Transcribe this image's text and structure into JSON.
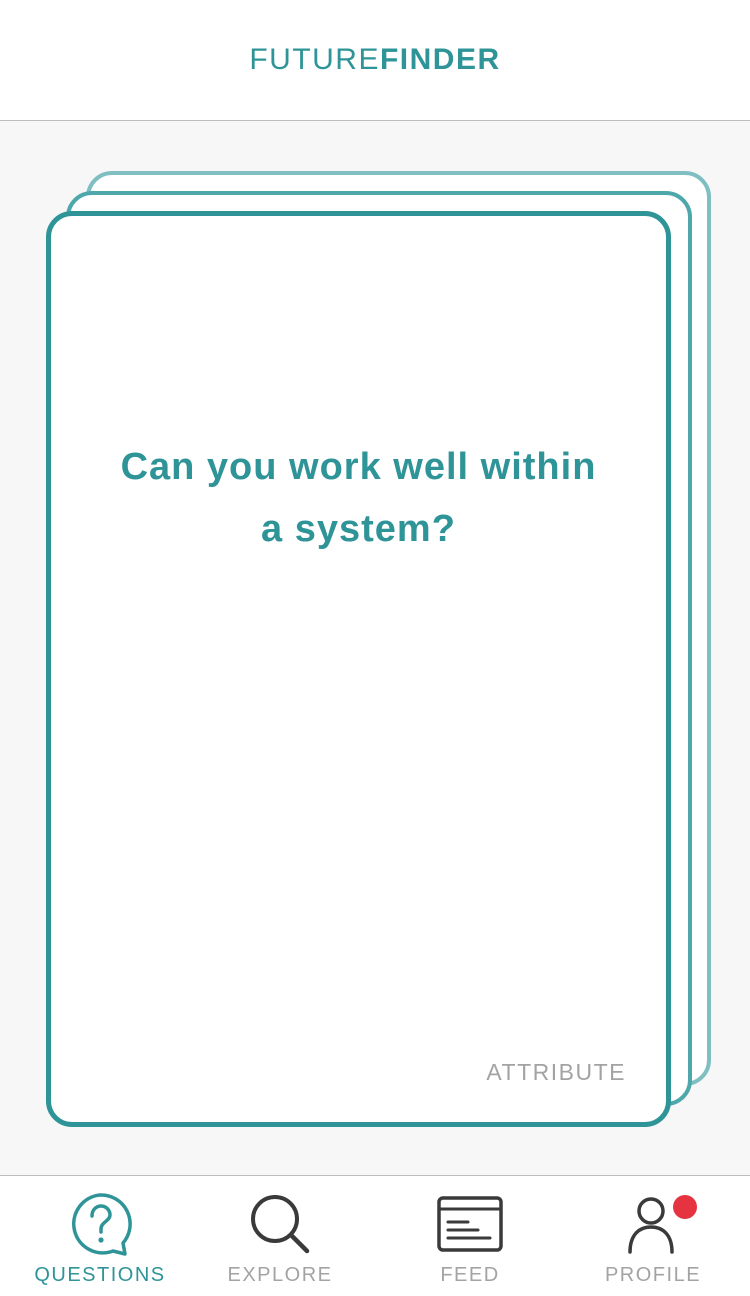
{
  "header": {
    "logo_light": "FUTURE",
    "logo_bold": "FINDER"
  },
  "card": {
    "question": "Can you work well within a system?",
    "category": "ATTRIBUTE"
  },
  "tabbar": {
    "tabs": [
      {
        "label": "QUESTIONS",
        "icon": "question-bubble-icon",
        "active": true
      },
      {
        "label": "EXPLORE",
        "icon": "search-icon",
        "active": false
      },
      {
        "label": "FEED",
        "icon": "feed-icon",
        "active": false
      },
      {
        "label": "PROFILE",
        "icon": "profile-icon",
        "active": false,
        "has_notification": true
      }
    ]
  },
  "colors": {
    "accent": "#2e9497",
    "inactive": "#a3a3a3",
    "notification": "#e63340",
    "background": "#f7f7f7"
  }
}
